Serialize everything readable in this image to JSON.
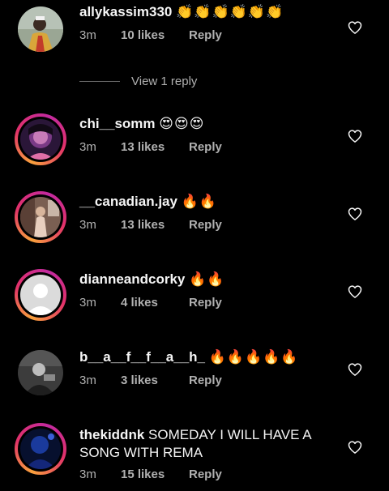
{
  "comments": [
    {
      "username": "allykassim330",
      "text": "",
      "emoji": "👏👏👏👏👏👏",
      "time": "3m",
      "likes": "10 likes",
      "reply_label": "Reply",
      "avatar": "photo-man-gold-outfit",
      "story_ring": false
    },
    {
      "username": "chi__somm",
      "text": "",
      "emoji": "😍😍😍",
      "time": "3m",
      "likes": "13 likes",
      "reply_label": "Reply",
      "avatar": "photo-woman-glowing",
      "story_ring": true
    },
    {
      "username": "__canadian.jay",
      "text": "",
      "emoji": "🔥🔥",
      "time": "3m",
      "likes": "13 likes",
      "reply_label": "Reply",
      "avatar": "photo-woman-room",
      "story_ring": true
    },
    {
      "username": "dianneandcorky",
      "text": "",
      "emoji": "🔥🔥",
      "time": "3m",
      "likes": "4 likes",
      "reply_label": "Reply",
      "avatar": "default-avatar",
      "story_ring": true
    },
    {
      "username": "b__a__f__f__a__h_",
      "text": "",
      "emoji": "🔥🔥🔥🔥🔥",
      "time": "3m",
      "likes": "3 likes",
      "reply_label": "Reply",
      "avatar": "photo-bw-man",
      "story_ring": false
    },
    {
      "username": "thekiddnk",
      "text": "SOMEDAY I WILL HAVE A SONG WITH REMA",
      "emoji": "",
      "time": "3m",
      "likes": "15 likes",
      "reply_label": "Reply",
      "avatar": "photo-blue-person",
      "story_ring": true
    }
  ],
  "view_replies": {
    "label": "View 1 reply"
  },
  "icons": {
    "like": "heart-outline-icon"
  },
  "colors": {
    "background": "#000000",
    "primary_text": "#f5f5f5",
    "secondary_text": "#b0b0b0",
    "story_ring_start": "#f9a13c",
    "story_ring_end": "#c22aa0"
  }
}
